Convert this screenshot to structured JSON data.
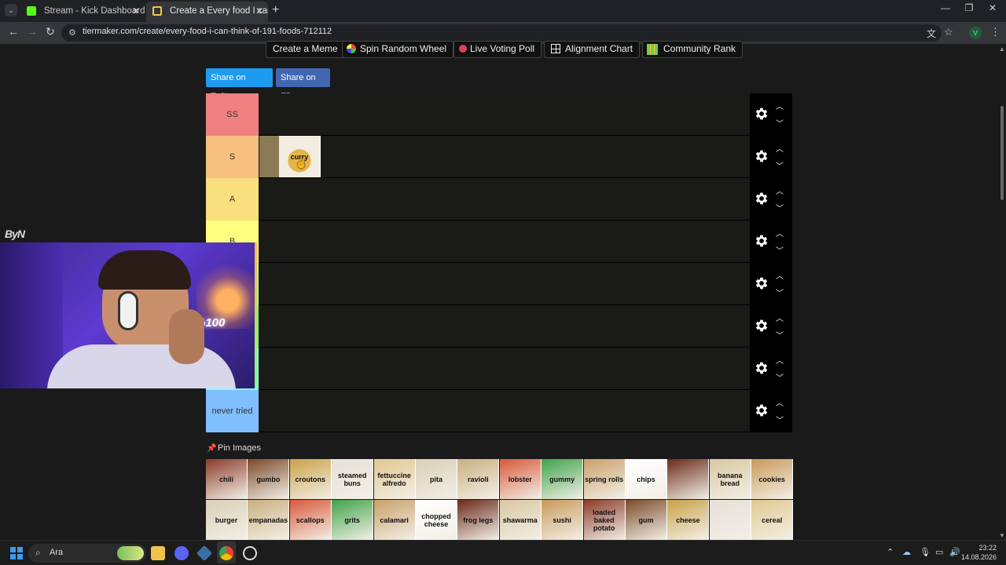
{
  "browser": {
    "tabs": [
      {
        "title": "Stream - Kick Dashboard",
        "favicon_color": "#53fc18"
      },
      {
        "title": "Create a Every food I can think",
        "favicon_color": "#f2c94c"
      }
    ],
    "url": "tiermaker.com/create/every-food-i-can-think-of-191-foods-712112",
    "profile_initial": "V"
  },
  "toolbar": {
    "buttons": [
      "Create a Meme",
      "Spin Random Wheel",
      "Live Voting Poll",
      "Alignment Chart",
      "Community Rank"
    ]
  },
  "share": {
    "twitter": "Share on Twitter",
    "facebook": "Share on FB"
  },
  "tiers": [
    {
      "label": "SS",
      "color": "#f07f7f"
    },
    {
      "label": "S",
      "color": "#f8c07f"
    },
    {
      "label": "A",
      "color": "#fadf7f"
    },
    {
      "label": "B",
      "color": "#fefe7f"
    },
    {
      "label": "",
      "color": "#bfff7f"
    },
    {
      "label": "",
      "color": "#7fff7f"
    },
    {
      "label": "",
      "color": "#7fffff"
    },
    {
      "label": "never tried",
      "color": "#7fbfff"
    }
  ],
  "placed_items": {
    "s_tier": [
      "curry"
    ]
  },
  "pin_images": {
    "label": "Pin Images",
    "row1": [
      "chili",
      "gumbo",
      "croutons",
      "steamed buns",
      "fettuccine alfredo",
      "pita",
      "ravioli",
      "lobster",
      "gummy",
      "spring rolls",
      "chips",
      "",
      "banana bread",
      "cookies"
    ],
    "row2": [
      "burger",
      "empanadas",
      "scallops",
      "grits",
      "calamari",
      "chopped cheese",
      "frog legs",
      "shawarma",
      "sushi",
      "loaded baked potato",
      "gum",
      "cheese",
      "",
      "cereal"
    ]
  },
  "webcam": {
    "watermark": "ByN",
    "neon_sign": "%100"
  },
  "taskbar": {
    "search_placeholder": "Ara",
    "time": "23:22",
    "date": "14.08.2026"
  }
}
